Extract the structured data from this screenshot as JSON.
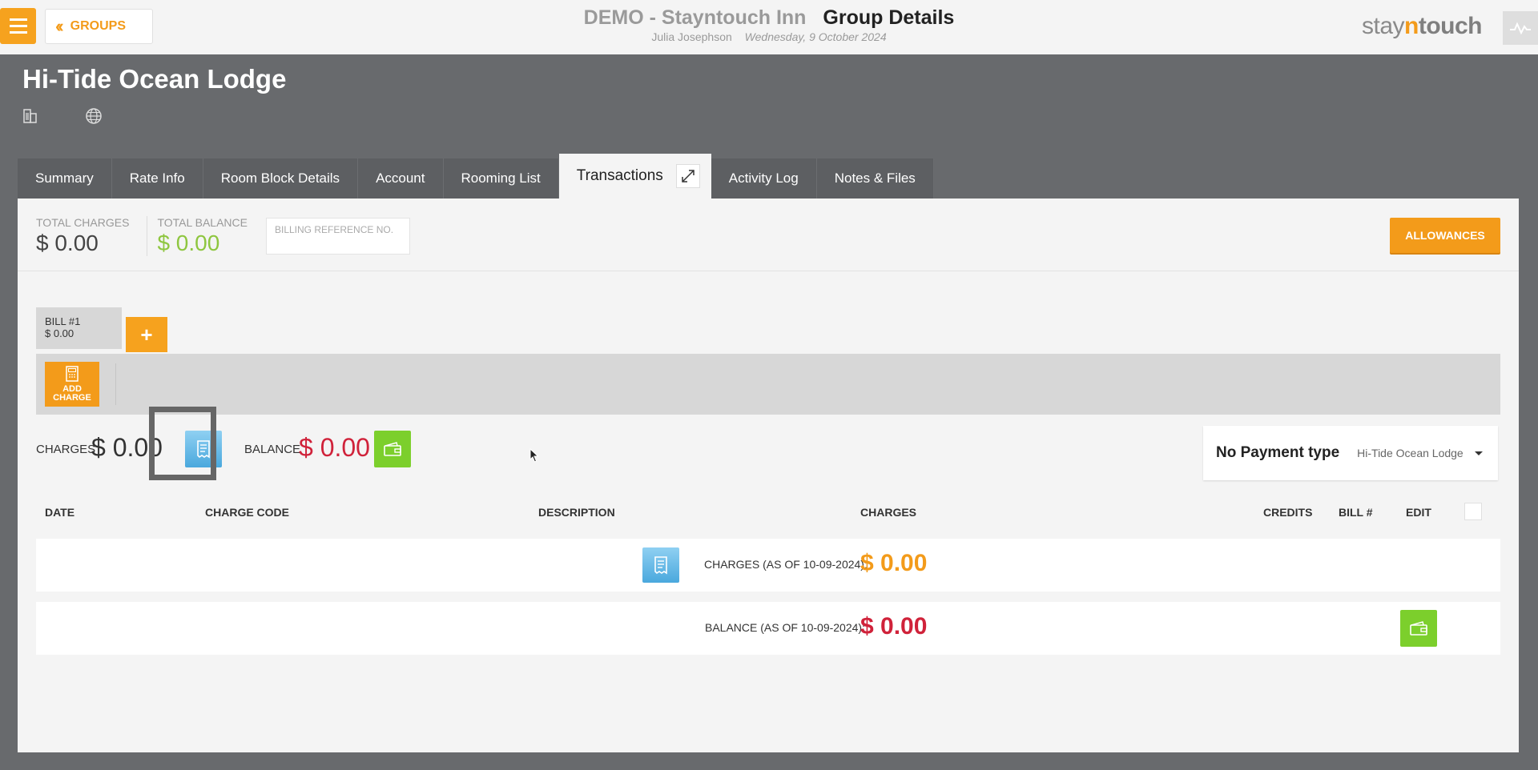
{
  "header": {
    "back_label": "GROUPS",
    "hotel_name": "DEMO - Stayntouch Inn",
    "page_title": "Group Details",
    "user_name": "Julia Josephson",
    "date": "Wednesday, 9 October 2024",
    "logo": {
      "part1": "stay",
      "part2": "n",
      "part3": "touch"
    }
  },
  "group": {
    "name": "Hi-Tide Ocean Lodge"
  },
  "tabs": [
    {
      "label": "Summary"
    },
    {
      "label": "Rate Info"
    },
    {
      "label": "Room Block Details"
    },
    {
      "label": "Account"
    },
    {
      "label": "Rooming List"
    },
    {
      "label": "Transactions",
      "active": true
    },
    {
      "label": "Activity Log"
    },
    {
      "label": "Notes & Files"
    }
  ],
  "totals": {
    "charges_label": "TOTAL CHARGES",
    "charges_value": "$ 0.00",
    "balance_label": "TOTAL BALANCE",
    "balance_value": "$ 0.00",
    "billing_ref_placeholder": "BILLING REFERENCE NO."
  },
  "allowances_label": "ALLOWANCES",
  "bill": {
    "name": "BILL #1",
    "amount": "$ 0.00",
    "add_bill_label": "+",
    "add_charge_line1": "ADD",
    "add_charge_line2": "CHARGE"
  },
  "summary": {
    "charges_label": "CHARGES",
    "charges_value": "$ 0.00",
    "balance_label": "BALANCE",
    "balance_value": "$ 0.00"
  },
  "payment": {
    "type": "No Payment type",
    "selected": "Hi-Tide Ocean Lodge"
  },
  "table": {
    "columns": [
      "DATE",
      "CHARGE CODE",
      "DESCRIPTION",
      "CHARGES",
      "CREDITS",
      "BILL #",
      "EDIT"
    ],
    "rows": [
      {
        "label": "CHARGES (AS OF 10-09-2024):",
        "value": "$ 0.00"
      },
      {
        "label": "BALANCE (AS OF 10-09-2024):",
        "value": "$ 0.00"
      }
    ]
  },
  "colors": {
    "accent": "#f39b1a",
    "balance_red": "#d0223a",
    "positive_green": "#8ec63f"
  },
  "icons": {
    "building": "building-icon",
    "globe": "globe-icon",
    "popout": "popout-icon",
    "receipt": "receipt-icon",
    "wallet": "wallet-icon",
    "pulse": "pulse-icon"
  }
}
